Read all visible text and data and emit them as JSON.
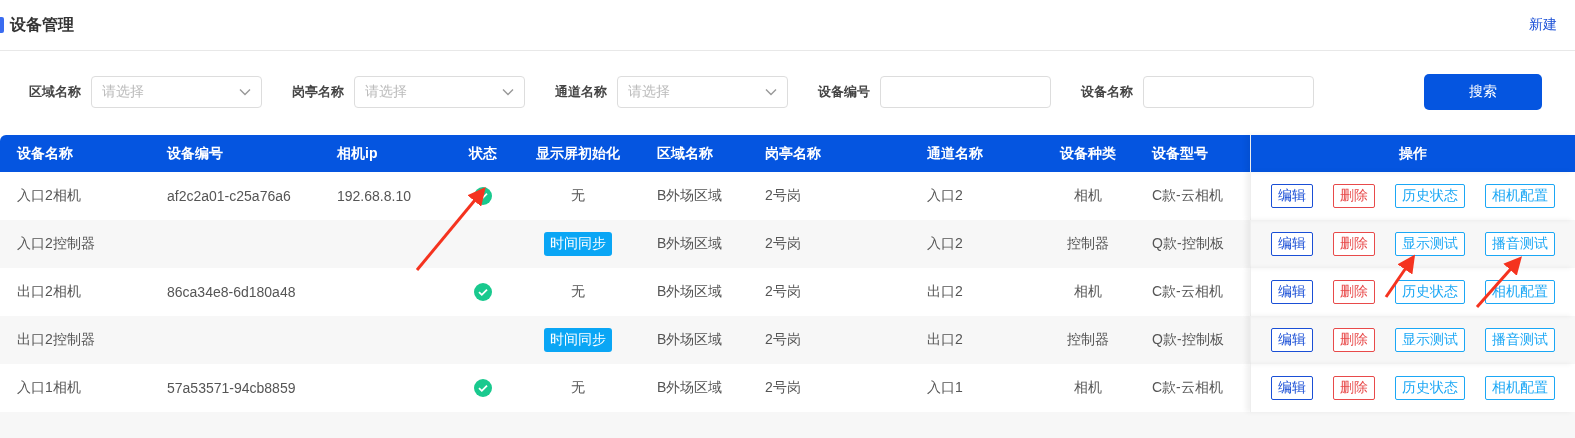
{
  "page": {
    "title": "设备管理",
    "new_link": "新建"
  },
  "filters": [
    {
      "kind": "select",
      "label": "区域名称",
      "placeholder": "请选择"
    },
    {
      "kind": "select",
      "label": "岗亭名称",
      "placeholder": "请选择"
    },
    {
      "kind": "select",
      "label": "通道名称",
      "placeholder": "请选择"
    },
    {
      "kind": "input",
      "label": "设备编号"
    },
    {
      "kind": "input",
      "label": "设备名称"
    }
  ],
  "search_button": "搜索",
  "table": {
    "columns": [
      "设备名称",
      "设备编号",
      "相机ip",
      "状态",
      "显示屏初始化",
      "区域名称",
      "岗亭名称",
      "通道名称",
      "设备种类",
      "设备型号",
      "操作"
    ],
    "rows": [
      {
        "name": "入口2相机",
        "code": "af2c2a01-c25a76a6",
        "ip": "192.68.8.10",
        "online": true,
        "init": {
          "kind": "text",
          "text": "无"
        },
        "area": "B外场区域",
        "booth": "2号岗",
        "channel": "入口2",
        "type": "相机",
        "model": "C款-云相机",
        "actions": [
          {
            "kind": "edit",
            "label": "编辑"
          },
          {
            "kind": "delete",
            "label": "删除"
          },
          {
            "kind": "normal",
            "label": "历史状态"
          },
          {
            "kind": "normal",
            "label": "相机配置"
          }
        ]
      },
      {
        "name": "入口2控制器",
        "online": false,
        "init": {
          "kind": "button",
          "text": "时间同步"
        },
        "area": "B外场区域",
        "booth": "2号岗",
        "channel": "入口2",
        "type": "控制器",
        "model": "Q款-控制板",
        "actions": [
          {
            "kind": "edit",
            "label": "编辑"
          },
          {
            "kind": "delete",
            "label": "删除"
          },
          {
            "kind": "normal",
            "label": "显示测试"
          },
          {
            "kind": "normal",
            "label": "播音测试"
          }
        ]
      },
      {
        "name": "出口2相机",
        "code": "86ca34e8-6d180a48",
        "online": true,
        "init": {
          "kind": "text",
          "text": "无"
        },
        "area": "B外场区域",
        "booth": "2号岗",
        "channel": "出口2",
        "type": "相机",
        "model": "C款-云相机",
        "actions": [
          {
            "kind": "edit",
            "label": "编辑"
          },
          {
            "kind": "delete",
            "label": "删除"
          },
          {
            "kind": "normal",
            "label": "历史状态"
          },
          {
            "kind": "normal",
            "label": "相机配置"
          }
        ]
      },
      {
        "name": "出口2控制器",
        "online": false,
        "init": {
          "kind": "button",
          "text": "时间同步"
        },
        "area": "B外场区域",
        "booth": "2号岗",
        "channel": "出口2",
        "type": "控制器",
        "model": "Q款-控制板",
        "actions": [
          {
            "kind": "edit",
            "label": "编辑"
          },
          {
            "kind": "delete",
            "label": "删除"
          },
          {
            "kind": "normal",
            "label": "显示测试"
          },
          {
            "kind": "normal",
            "label": "播音测试"
          }
        ]
      },
      {
        "name": "入口1相机",
        "code": "57a53571-94cb8859",
        "online": true,
        "init": {
          "kind": "text",
          "text": "无"
        },
        "area": "B外场区域",
        "booth": "2号岗",
        "channel": "入口1",
        "type": "相机",
        "model": "C款-云相机",
        "actions": [
          {
            "kind": "edit",
            "label": "编辑"
          },
          {
            "kind": "delete",
            "label": "删除"
          },
          {
            "kind": "normal",
            "label": "历史状态"
          },
          {
            "kind": "normal",
            "label": "相机配置"
          }
        ]
      }
    ]
  }
}
